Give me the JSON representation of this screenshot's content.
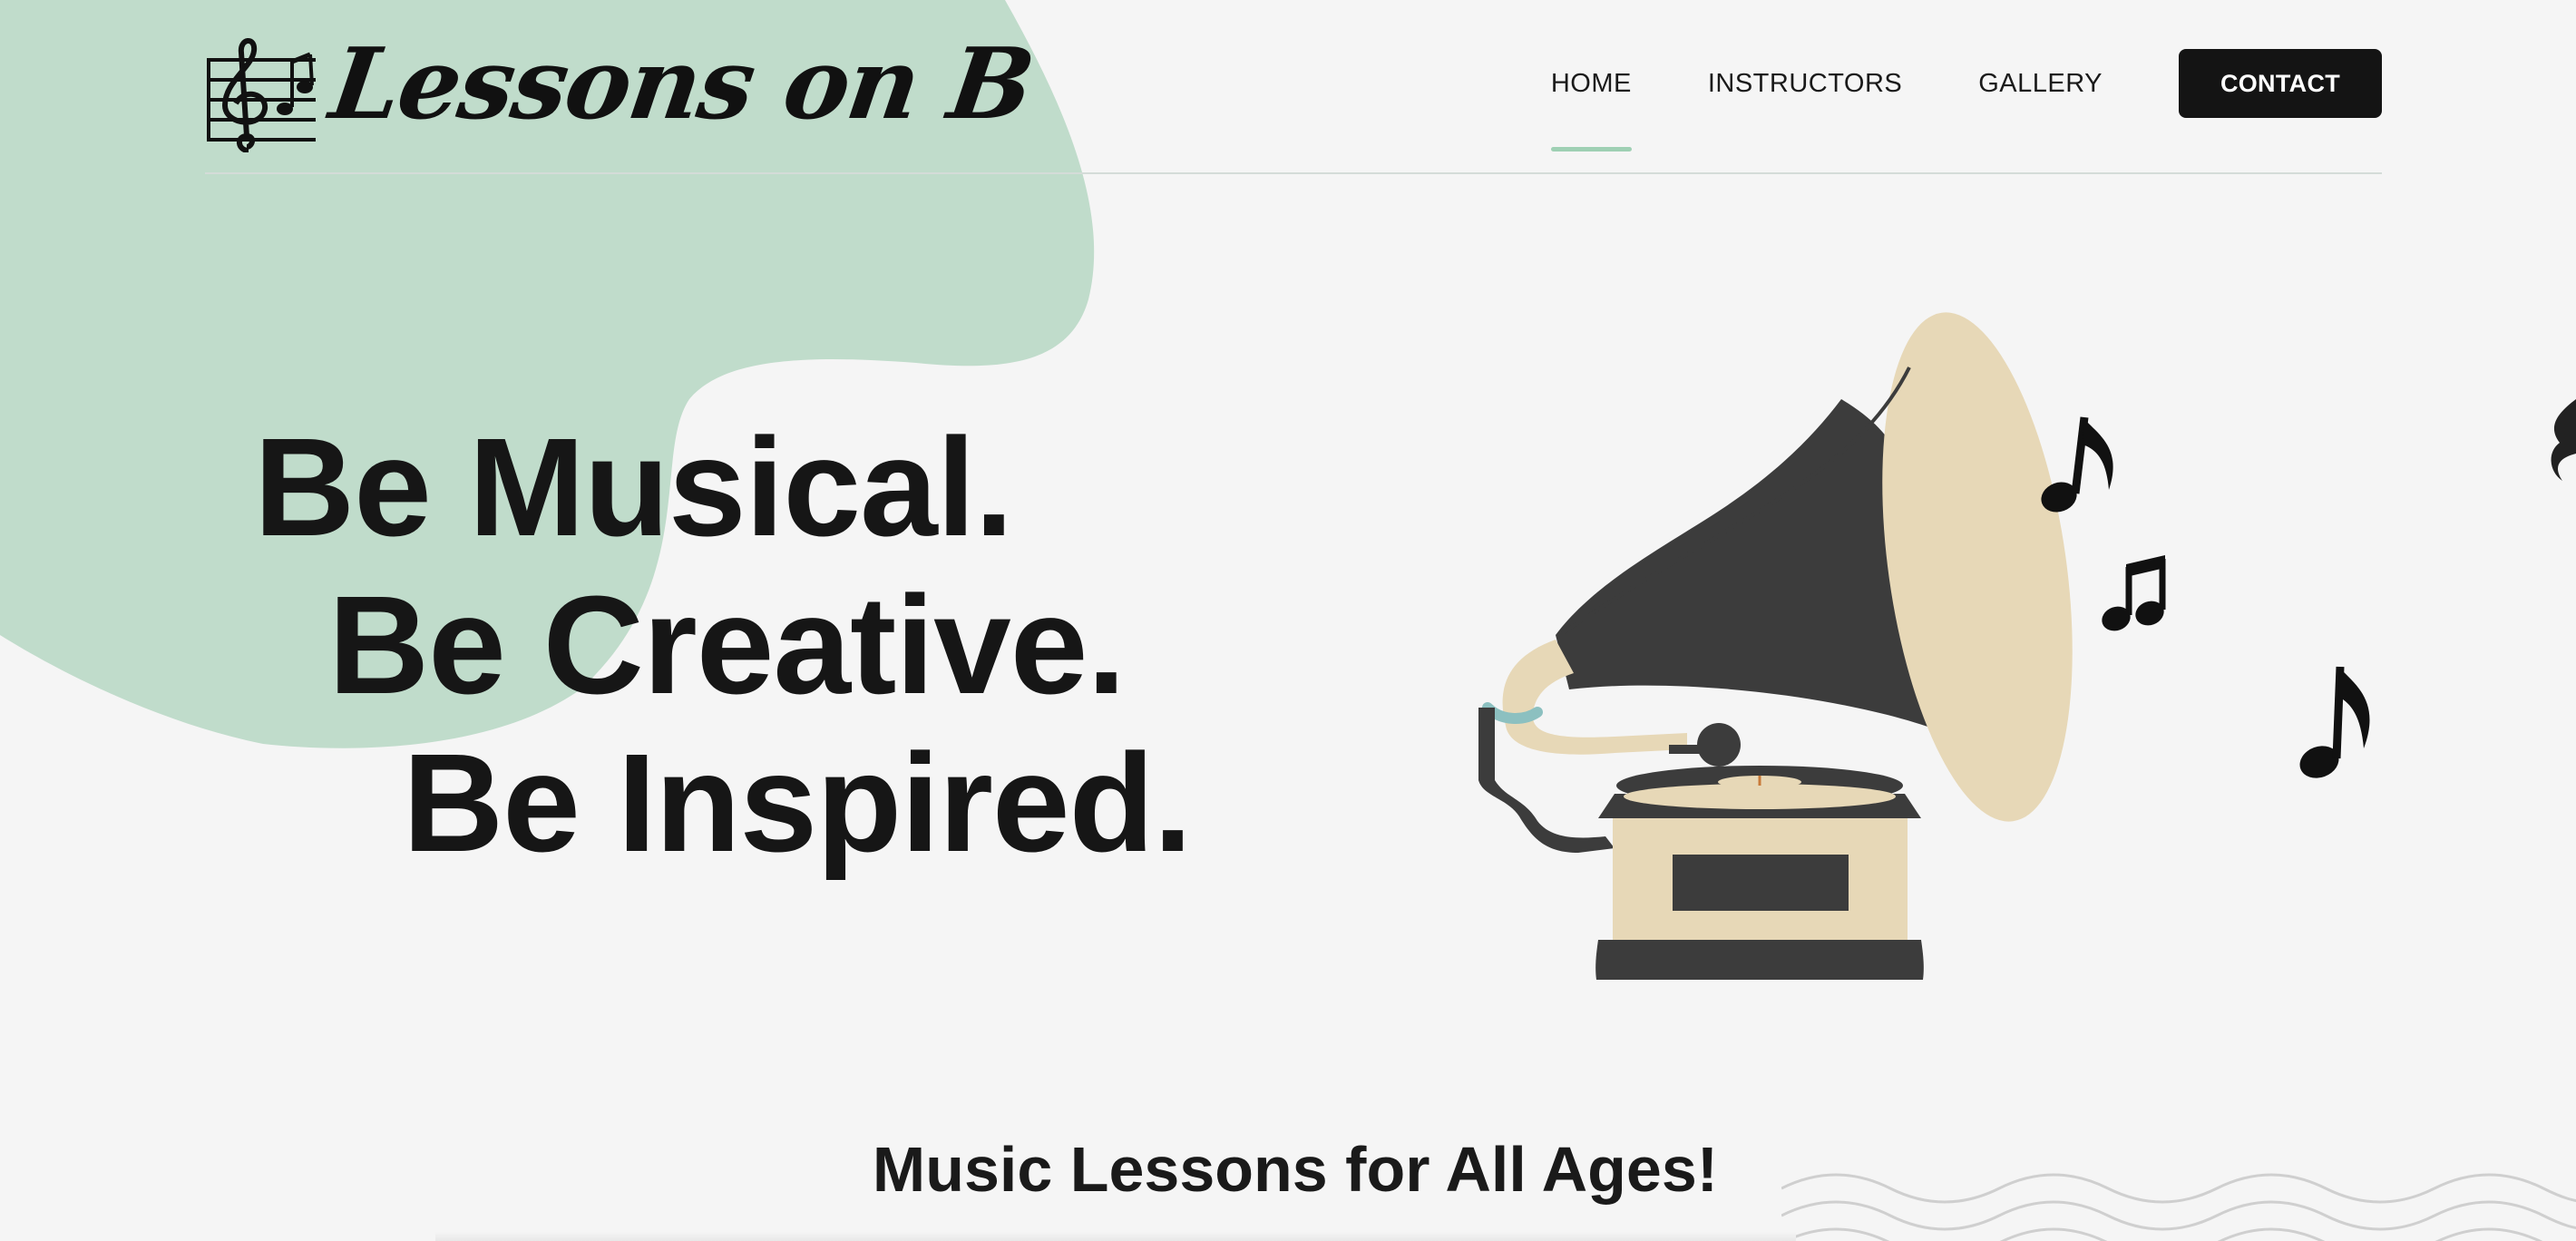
{
  "brand": {
    "name": "Lessons on B",
    "logo_icon": "treble-clef-staff-icon",
    "blob_color": "#c0dccb",
    "accent_color": "#9fd0b4"
  },
  "nav": {
    "items": [
      {
        "label": "HOME",
        "active": true
      },
      {
        "label": "INSTRUCTORS",
        "active": false
      },
      {
        "label": "GALLERY",
        "active": false
      }
    ],
    "contact_label": "CONTACT"
  },
  "hero": {
    "lines": [
      "Be Musical.",
      "Be Creative.",
      "Be Inspired."
    ],
    "illustration": "gramophone-icon",
    "notes": [
      "eighth-note-icon",
      "beamed-notes-icon",
      "eighth-note-icon"
    ]
  },
  "section": {
    "title": "Music Lessons for All Ages!"
  }
}
